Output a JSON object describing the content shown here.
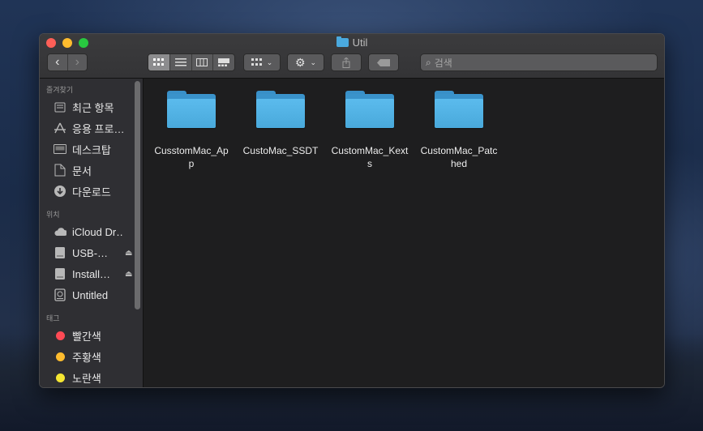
{
  "window": {
    "title": "Util"
  },
  "toolbar": {
    "back_label": "‹",
    "forward_label": "›",
    "search_placeholder": "검색"
  },
  "sidebar": {
    "favorites_header": "즐겨찾기",
    "favorites": [
      {
        "label": "최근 항목",
        "icon": "clock-icon"
      },
      {
        "label": "응용 프로…",
        "icon": "applications-icon"
      },
      {
        "label": "데스크탑",
        "icon": "desktop-icon"
      },
      {
        "label": "문서",
        "icon": "documents-icon"
      },
      {
        "label": "다운로드",
        "icon": "downloads-icon"
      }
    ],
    "locations_header": "위치",
    "locations": [
      {
        "label": "iCloud Dr…",
        "icon": "cloud-icon"
      },
      {
        "label": "USB-…",
        "icon": "drive-icon"
      },
      {
        "label": "Install…",
        "icon": "drive-icon"
      },
      {
        "label": "Untitled",
        "icon": "disk-icon"
      }
    ],
    "tags_header": "태그",
    "tags": [
      {
        "label": "빨간색",
        "color": "#fe4a55"
      },
      {
        "label": "주황색",
        "color": "#febc2e"
      },
      {
        "label": "노란색",
        "color": "#f5e632"
      }
    ]
  },
  "files": [
    {
      "name": "CusstomMac_App"
    },
    {
      "name": "CustoMac_SSDT"
    },
    {
      "name": "CustomMac_Kexts"
    },
    {
      "name": "CustomMac_Patched"
    }
  ],
  "colors": {
    "folder": "#4aa9de",
    "accent": "#28c840"
  }
}
